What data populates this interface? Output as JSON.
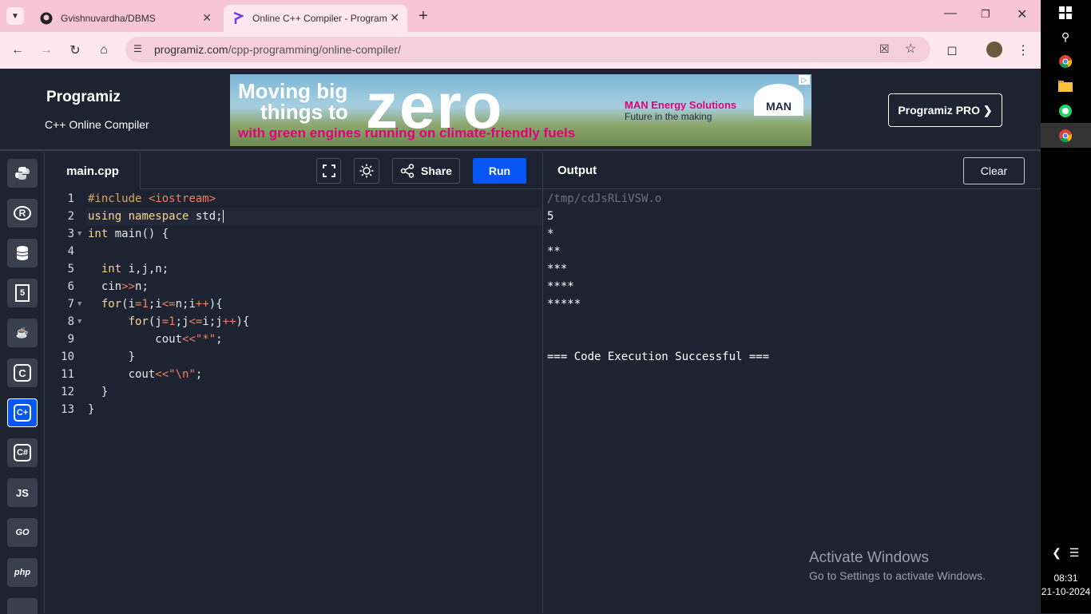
{
  "browser": {
    "tabs": [
      {
        "title": "Gvishnuvardha/DBMS",
        "icon": "github-icon"
      },
      {
        "title": "Online C++ Compiler - Program",
        "icon": "programiz-icon"
      }
    ],
    "url_host": "programiz.com",
    "url_path": "/cpp-programming/online-compiler/"
  },
  "header": {
    "logo": "Programiz",
    "subtitle": "C++ Online Compiler",
    "pro_button": "Programiz PRO ❯",
    "ad": {
      "line1": "Moving big",
      "line2": "things to",
      "big": "zero",
      "line3": "with green engines running on climate-friendly fuels",
      "brand": "MAN Energy Solutions",
      "tagline": "Future in the making",
      "logo": "MAN"
    }
  },
  "languages": [
    {
      "name": "python-icon",
      "label": ""
    },
    {
      "name": "r-icon",
      "label": "R"
    },
    {
      "name": "sql-icon",
      "label": ""
    },
    {
      "name": "html5-icon",
      "label": "5"
    },
    {
      "name": "java-icon",
      "label": ""
    },
    {
      "name": "c-icon",
      "label": "C"
    },
    {
      "name": "cpp-icon",
      "label": "C+"
    },
    {
      "name": "csharp-icon",
      "label": "C#"
    },
    {
      "name": "js-icon",
      "label": "JS"
    },
    {
      "name": "go-icon",
      "label": "GO"
    },
    {
      "name": "php-icon",
      "label": "php"
    }
  ],
  "editor": {
    "filename": "main.cpp",
    "share_label": "Share",
    "run_label": "Run",
    "line_numbers": [
      "1",
      "2",
      "3",
      "4",
      "5",
      "6",
      "7",
      "8",
      "9",
      "10",
      "11",
      "12",
      "13"
    ]
  },
  "output": {
    "title": "Output",
    "clear_label": "Clear",
    "lines": [
      "/tmp/cdJsRLiVSW.o",
      "5",
      "*",
      "**",
      "***",
      "****",
      "*****",
      "",
      "",
      "=== Code Execution Successful ==="
    ]
  },
  "windows": {
    "activate_title": "Activate Windows",
    "activate_sub": "Go to Settings to activate Windows.",
    "time": "08:31",
    "date": "21-10-2024"
  }
}
